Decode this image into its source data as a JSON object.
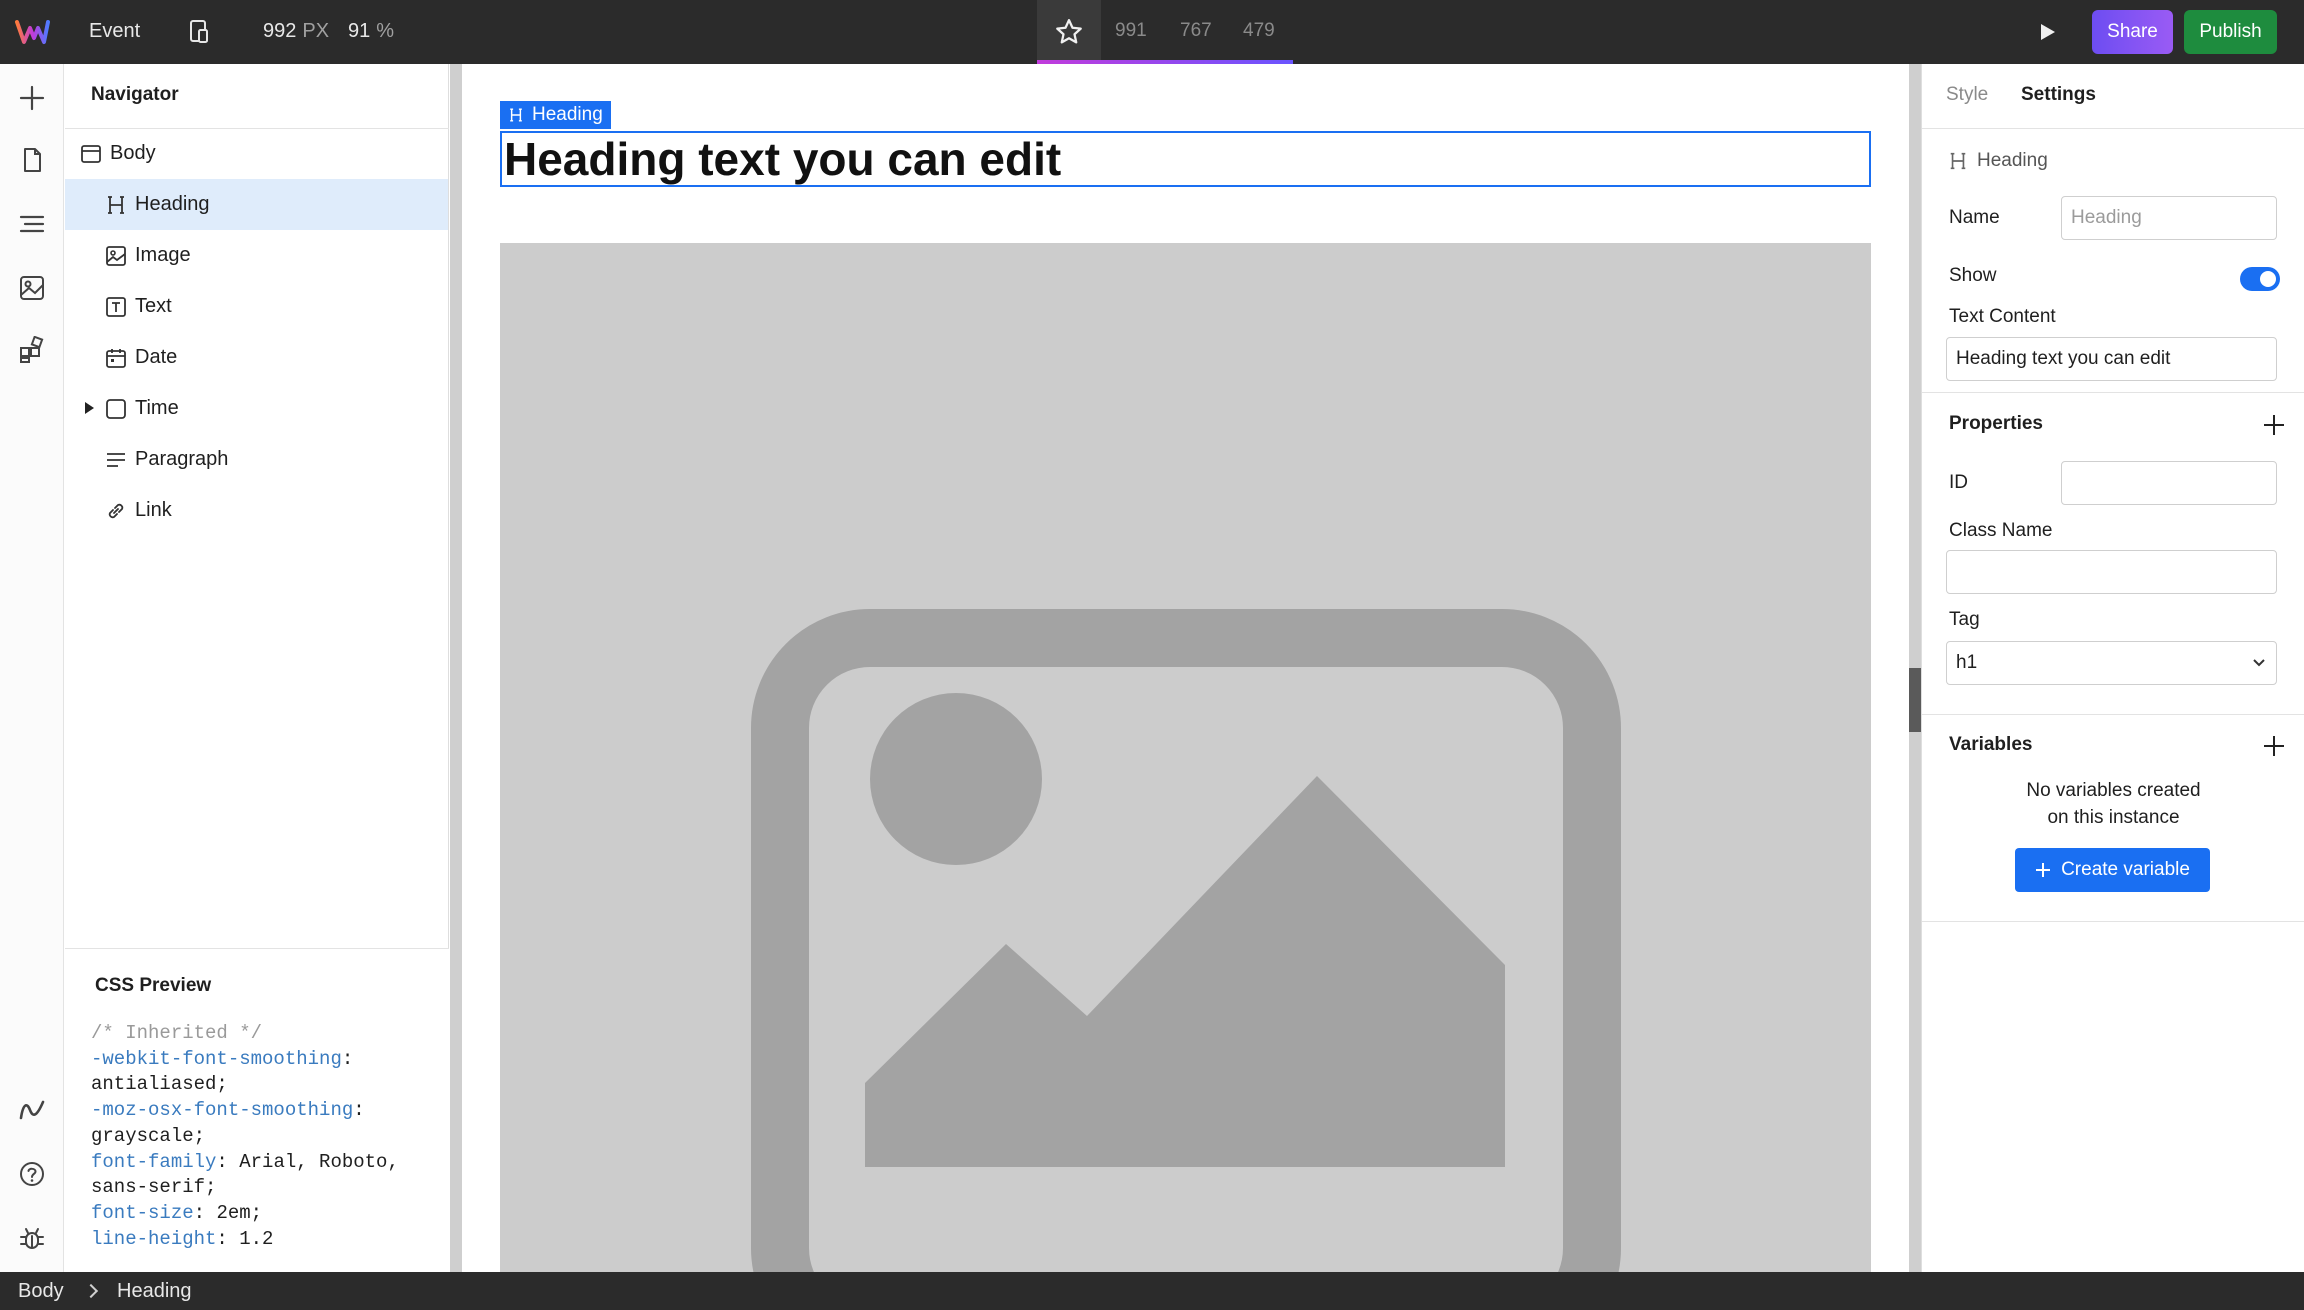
{
  "topbar": {
    "project_name": "Event",
    "canvas_width": "992",
    "canvas_width_unit": "PX",
    "zoom": "91",
    "zoom_unit": "%",
    "breakpoints": [
      "991",
      "767",
      "479"
    ],
    "share_label": "Share",
    "publish_label": "Publish",
    "accent_gradient": [
      "#c13bdb",
      "#6a54ff"
    ],
    "publish_color": "#1e8c3e"
  },
  "navigator": {
    "title": "Navigator",
    "items": [
      {
        "label": "Body",
        "icon": "body-icon"
      },
      {
        "label": "Heading",
        "icon": "heading-icon",
        "selected": true
      },
      {
        "label": "Image",
        "icon": "image-icon"
      },
      {
        "label": "Text",
        "icon": "text-icon"
      },
      {
        "label": "Date",
        "icon": "calendar-icon"
      },
      {
        "label": "Time",
        "icon": "box-icon",
        "collapsed": true
      },
      {
        "label": "Paragraph",
        "icon": "paragraph-icon"
      },
      {
        "label": "Link",
        "icon": "link-icon"
      }
    ]
  },
  "css_preview": {
    "title": "CSS Preview",
    "comment": "/* Inherited */",
    "lines": [
      {
        "prop": "-webkit-font-smoothing",
        "value": "antialiased"
      },
      {
        "prop": "-moz-osx-font-smoothing",
        "value": "grayscale"
      },
      {
        "prop": "font-family",
        "value": "Arial, Roboto, sans-serif"
      },
      {
        "prop": "font-size",
        "value": "2em"
      },
      {
        "prop": "line-height",
        "value": "1.2"
      }
    ]
  },
  "canvas": {
    "selection_label": "Heading",
    "heading_text": "Heading text you can edit"
  },
  "settings": {
    "tabs": [
      "Style",
      "Settings"
    ],
    "active_tab": "Settings",
    "component_name": "Heading",
    "name_label": "Name",
    "name_placeholder": "Heading",
    "show_label": "Show",
    "show_value": true,
    "text_content_label": "Text Content",
    "text_content_value": "Heading text you can edit",
    "properties_title": "Properties",
    "id_label": "ID",
    "id_value": "",
    "class_label": "Class Name",
    "class_value": "",
    "tag_label": "Tag",
    "tag_value": "h1",
    "variables_title": "Variables",
    "empty_message_1": "No variables created",
    "empty_message_2": "on this instance",
    "create_variable_label": "Create variable",
    "accent_color": "#1a6ff2"
  },
  "statusbar": {
    "crumbs": [
      "Body",
      "Heading"
    ]
  }
}
